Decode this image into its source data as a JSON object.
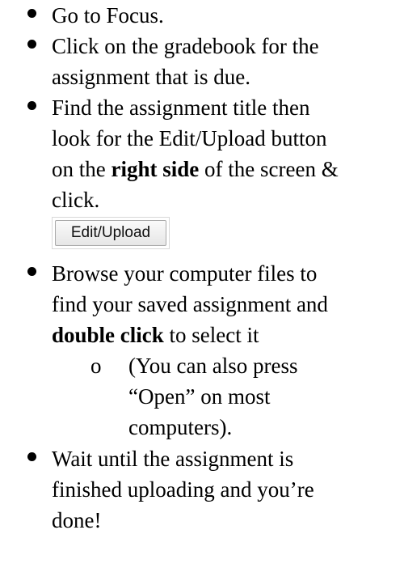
{
  "instructions": [
    {
      "lines": [
        "Go to Focus."
      ]
    },
    {
      "lines": [
        "Click on the gradebook for the",
        "assignment that is due."
      ]
    },
    {
      "line1": "Find the assignment title then",
      "line2": "look for the Edit/Upload button",
      "line3_before": "on the ",
      "line3_bold": "right side",
      "line3_after": " of the screen &",
      "line4": "click."
    },
    {
      "line1": "Browse your computer files to",
      "line2": "find your saved assignment and",
      "line3_bold": "double click",
      "line3_after": " to select it"
    },
    {
      "lines": [
        "Wait until the assignment is",
        "finished uploading and you’re",
        "done!"
      ]
    }
  ],
  "upload_button": {
    "label": "Edit/Upload"
  },
  "sub_note": {
    "marker": "o",
    "lines": [
      "(You can also press",
      "“Open” on most",
      "computers)."
    ]
  }
}
